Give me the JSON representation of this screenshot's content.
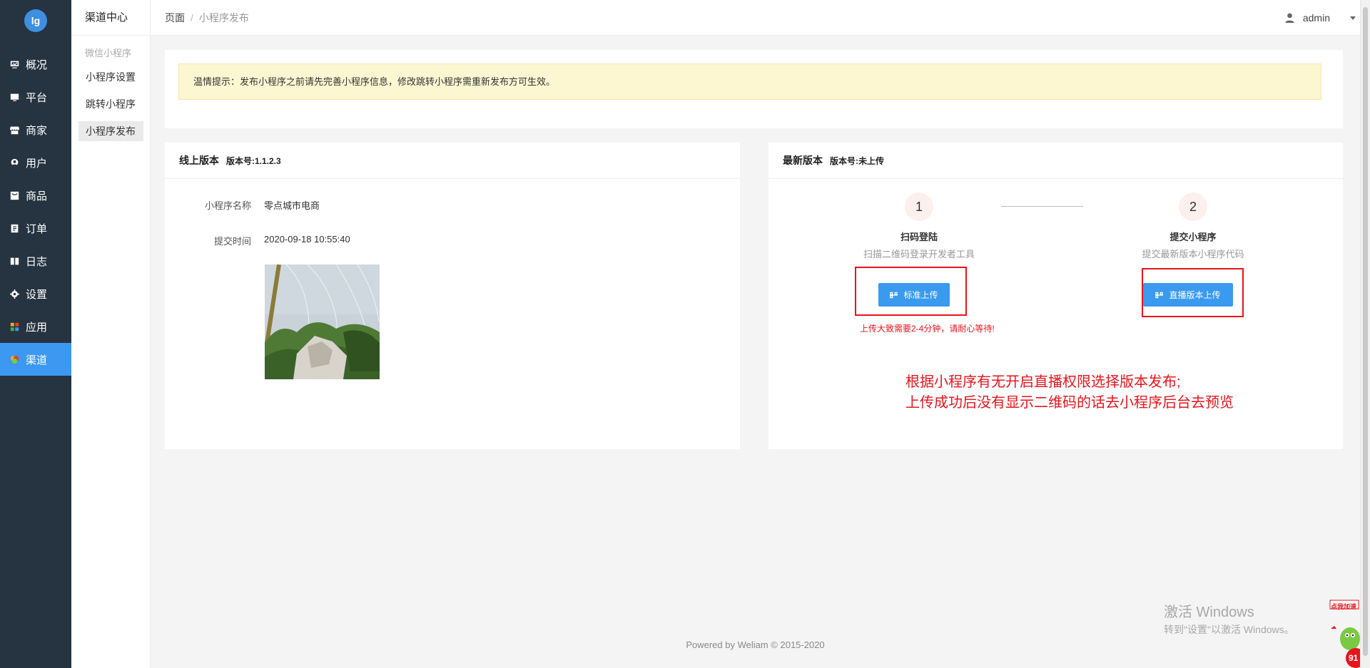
{
  "nav": {
    "logo": "lg",
    "items": [
      {
        "label": "概况",
        "icon": "dashboard-icon"
      },
      {
        "label": "平台",
        "icon": "monitor-icon"
      },
      {
        "label": "商家",
        "icon": "store-icon"
      },
      {
        "label": "用户",
        "icon": "user-icon"
      },
      {
        "label": "商品",
        "icon": "goods-icon"
      },
      {
        "label": "订单",
        "icon": "order-icon"
      },
      {
        "label": "日志",
        "icon": "log-icon"
      },
      {
        "label": "设置",
        "icon": "gear-icon"
      },
      {
        "label": "应用",
        "icon": "apps-icon"
      },
      {
        "label": "渠道",
        "icon": "channel-icon",
        "active": true
      }
    ]
  },
  "subnav": {
    "title": "渠道中心",
    "group": "微信小程序",
    "items": [
      "小程序设置",
      "跳转小程序",
      "小程序发布"
    ],
    "active_index": 2
  },
  "header": {
    "crumb_root": "页面",
    "crumb_sep": "/",
    "crumb_current": "小程序发布",
    "username": "admin"
  },
  "notice": "温情提示：发布小程序之前请先完善小程序信息，修改跳转小程序需重新发布方可生效。",
  "online": {
    "title": "线上版本",
    "version": "版本号:1.1.2.3",
    "name_label": "小程序名称",
    "name_value": "零点城市电商",
    "time_label": "提交时间",
    "time_value": "2020-09-18 10:55:40"
  },
  "latest": {
    "title": "最新版本",
    "version": "版本号:未上传",
    "steps": [
      {
        "num": "1",
        "title": "扫码登陆",
        "desc": "扫描二维码登录开发者工具"
      },
      {
        "num": "2",
        "title": "提交小程序",
        "desc": "提交最新版本小程序代码"
      }
    ],
    "btn_standard": "标准上传",
    "btn_live": "直播版本上传",
    "upload_tip": "上传大致需要2-4分钟，请耐心等待!",
    "annotation_line1": "根据小程序有无开启直播权限选择版本发布;",
    "annotation_line2": "上传成功后没有显示二维码的话去小程序后台去预览"
  },
  "footer": "Powered by Weliam © 2015-2020",
  "watermark": {
    "line1": "激活 Windows",
    "line2": "转到\"设置\"以激活 Windows。"
  },
  "float_badge": {
    "label": "点我加速",
    "count": "91"
  },
  "colors": {
    "nav_bg": "#263340",
    "accent": "#3c98f0",
    "annotation_red": "#e8141c",
    "notice_bg": "#fcf7d1"
  }
}
